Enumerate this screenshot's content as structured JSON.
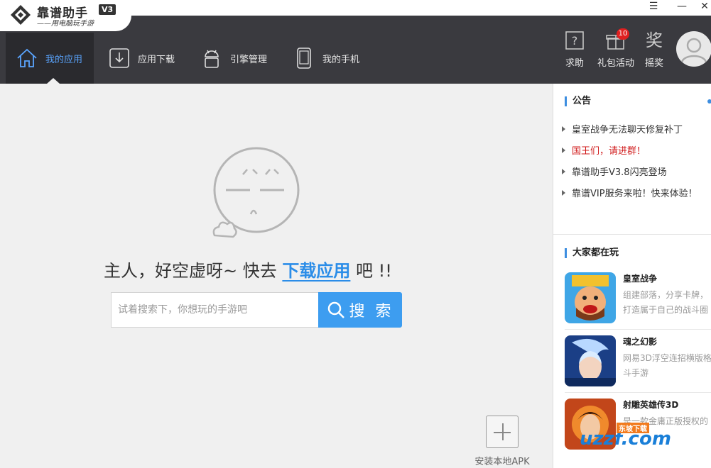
{
  "app": {
    "name": "靠谱助手",
    "version": "V3",
    "slogan": "——用电脑玩手游"
  },
  "window_controls": {
    "menu": "☰",
    "minimize": "—",
    "close": "✕"
  },
  "nav": {
    "tabs": [
      {
        "label": "我的应用",
        "icon": "home-icon",
        "active": true
      },
      {
        "label": "应用下载",
        "icon": "download-icon",
        "active": false
      },
      {
        "label": "引擎管理",
        "icon": "android-icon",
        "active": false
      },
      {
        "label": "我的手机",
        "icon": "phone-icon",
        "active": false
      }
    ],
    "tools": [
      {
        "label": "求助",
        "icon": "help-icon"
      },
      {
        "label": "礼包活动",
        "icon": "gift-icon",
        "badge": "10"
      },
      {
        "label": "摇奖",
        "icon": "lottery-icon",
        "glyph": "奖"
      }
    ]
  },
  "main": {
    "empty_text_before": "主人，好空虚呀~ 快去",
    "empty_link": "下载应用",
    "empty_text_after": "吧 !!",
    "search_placeholder": "试着搜索下，你想玩的手游吧",
    "search_button": "搜 索",
    "install_apk": "安装本地APK"
  },
  "sidebar": {
    "notice_title": "公告",
    "notices": [
      {
        "text": "皇室战争无法聊天修复补丁",
        "highlight": false
      },
      {
        "text": "国王们，请进群！",
        "highlight": true
      },
      {
        "text": "靠谱助手V3.8闪亮登场",
        "highlight": false
      },
      {
        "text": "靠谱VIP服务来啦！快来体验！",
        "highlight": false
      }
    ],
    "popular_title": "大家都在玩",
    "games": [
      {
        "name": "皇室战争",
        "desc": "组建部落，分享卡牌，打造属于自己的战斗圈"
      },
      {
        "name": "魂之幻影",
        "desc": "网易3D浮空连招横版格斗手游"
      },
      {
        "name": "射雕英雄传3D",
        "desc": "是一款金庸正版授权的"
      }
    ]
  },
  "watermark": {
    "text": "uzzf.com",
    "tag": "东坡下载"
  },
  "colors": {
    "accent": "#3d9df0",
    "nav_bg": "#3a3a3f",
    "alert": "#d0191a"
  }
}
